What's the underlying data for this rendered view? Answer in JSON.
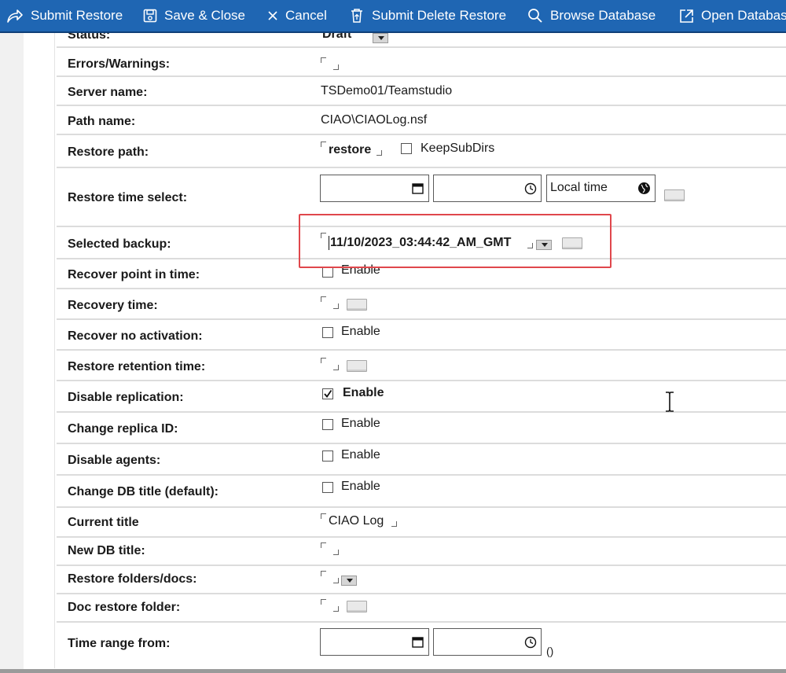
{
  "toolbar": {
    "submit_restore": "Submit Restore",
    "save_close": "Save & Close",
    "cancel": "Cancel",
    "submit_delete_restore": "Submit Delete Restore",
    "browse_database": "Browse Database",
    "open_database": "Open Databas"
  },
  "form": {
    "status": {
      "label": "Status:",
      "value": "Draft"
    },
    "errors": {
      "label": "Errors/Warnings:"
    },
    "server": {
      "label": "Server name:",
      "value": "TSDemo01/Teamstudio"
    },
    "path": {
      "label": "Path name:",
      "value": "CIAO\\CIAOLog.nsf"
    },
    "restore_path": {
      "label": "Restore path:",
      "value": "restore",
      "option": "KeepSubDirs"
    },
    "restore_time": {
      "label": "Restore time select:",
      "timezone": "Local time"
    },
    "selected_backup": {
      "label": "Selected backup:",
      "value": "11/10/2023_03:44:42_AM_GMT"
    },
    "recover_point": {
      "label": "Recover point in time:",
      "option": "Enable"
    },
    "recovery_time": {
      "label": "Recovery time:"
    },
    "recover_no_activation": {
      "label": "Recover no activation:",
      "option": "Enable"
    },
    "restore_retention": {
      "label": "Restore retention time:"
    },
    "disable_replication": {
      "label": "Disable replication:",
      "option": "Enable",
      "checked": true
    },
    "change_replica": {
      "label": "Change replica ID:",
      "option": "Enable"
    },
    "disable_agents": {
      "label": "Disable agents:",
      "option": "Enable"
    },
    "change_title": {
      "label": "Change DB title (default):",
      "option": "Enable"
    },
    "current_title": {
      "label": "Current title",
      "value": "CIAO Log"
    },
    "new_title": {
      "label": "New DB title:"
    },
    "restore_folders": {
      "label": "Restore folders/docs:"
    },
    "doc_folder": {
      "label": "Doc restore folder:"
    },
    "time_range": {
      "label": "Time range from:",
      "suffix": "()"
    }
  },
  "colors": {
    "toolbar_bg": "#1f66b3",
    "highlight": "#e0474c",
    "row_border": "#dcdcdc"
  }
}
